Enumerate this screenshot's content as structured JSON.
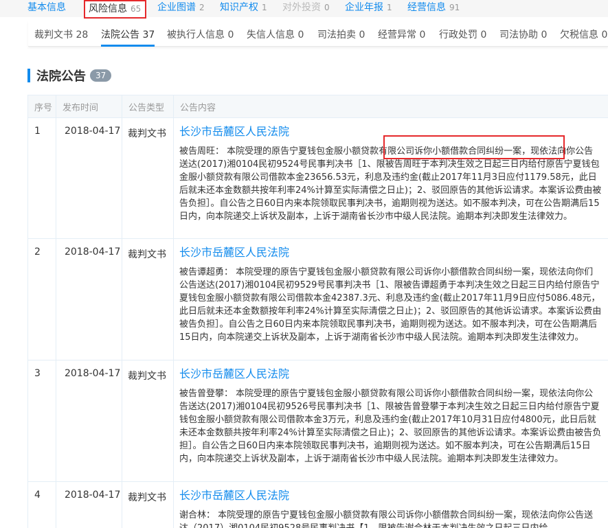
{
  "top_tabs": [
    {
      "label": "基本信息",
      "count": ""
    },
    {
      "label": "风险信息",
      "count": "65"
    },
    {
      "label": "企业图谱",
      "count": "2"
    },
    {
      "label": "知识产权",
      "count": "1"
    },
    {
      "label": "对外投资",
      "count": "0"
    },
    {
      "label": "企业年报",
      "count": "1"
    },
    {
      "label": "经营信息",
      "count": "91"
    }
  ],
  "sub_tabs": [
    {
      "label": "裁判文书",
      "count": "28"
    },
    {
      "label": "法院公告",
      "count": "37"
    },
    {
      "label": "被执行人信息",
      "count": "0"
    },
    {
      "label": "失信人信息",
      "count": "0"
    },
    {
      "label": "司法拍卖",
      "count": "0"
    },
    {
      "label": "经营异常",
      "count": "0"
    },
    {
      "label": "行政处罚",
      "count": "0"
    },
    {
      "label": "司法协助",
      "count": "0"
    },
    {
      "label": "欠税信息",
      "count": "0"
    }
  ],
  "section": {
    "title": "法院公告",
    "badge": "37"
  },
  "table": {
    "headers": [
      "序号",
      "发布时间",
      "公告类型",
      "公告内容"
    ],
    "rows": [
      {
        "no": "1",
        "date": "2018-04-17",
        "type": "裁判文书",
        "court": "长沙市岳麓区人民法院",
        "text": "被告周旺： 本院受理的原告宁夏钱包金服小额贷款有限公司诉你小额借款合同纠纷一案，现依法向你公告送达(2017)湘0104民初9524号民事判决书［1、限被告周旺于本判决生效之日起三日内给付原告宁夏钱包金服小额贷款有限公司借款本金23656.53元，利息及违约金(截止2017年11月3日应付1179.58元，此日后就未还本金数额共按年利率24%计算至实际清偿之日止)；2、驳回原告的其他诉讼请求。本案诉讼费由被告负担］。自公告之日60日内来本院领取民事判决书，逾期则视为送达。如不服本判决，可在公告期满后15日内，向本院递交上诉状及副本，上诉于湖南省长沙市中级人民法院。逾期本判决即发生法律效力。"
      },
      {
        "no": "2",
        "date": "2018-04-17",
        "type": "裁判文书",
        "court": "长沙市岳麓区人民法院",
        "text": "被告谭超勇： 本院受理的原告宁夏钱包金服小额贷款有限公司诉你小额借款合同纠纷一案，现依法向你们公告送达(2017)湘0104民初9529号民事判决书［1、限被告谭超勇于本判决生效之日起三日内给付原告宁夏钱包金服小额贷款有限公司借款本金42387.3元、利息及违约金(截止2017年11月9日应付5086.48元，此日后就未还本金数额按年利率24%计算至实际清偿之日止)；2、驳回原告的其他诉讼请求。本案诉讼费由被告负担］。自公告之日60日内来本院领取民事判决书，逾期则视为送达。如不服本判决，可在公告期满后15日内，向本院递交上诉状及副本，上诉于湖南省长沙市中级人民法院。逾期本判决即发生法律效力。"
      },
      {
        "no": "3",
        "date": "2018-04-17",
        "type": "裁判文书",
        "court": "长沙市岳麓区人民法院",
        "text": "被告曾登攀： 本院受理的原告宁夏钱包金服小额贷款有限公司诉你小额借款合同纠纷一案，现依法向你公告送达(2017)湘0104民初9526号民事判决书［1、限被告曾登攀于本判决生效之日起三日内给付原告宁夏钱包金服小额贷款有限公司借款本金3万元，利息及违约金(截止2017年10月31日应付4800元，此日后就未还本金数额共按年利率24%计算至实际清偿之日止)；2、驳回原告的其他诉讼请求。本案诉讼费由被告负担］。自公告之日60日内来本院领取民事判决书，逾期则视为送达。如不服本判决，可在公告期满后15日内，向本院递交上诉状及副本，上诉于湖南省长沙市中级人民法院。逾期本判决即发生法律效力。"
      },
      {
        "no": "4",
        "date": "2018-04-17",
        "type": "裁判文书",
        "court": "长沙市岳麓区人民法院",
        "text": "谢合林： 本院受理的原告宁夏钱包金服小额贷款有限公司诉你小额借款合同纠纷一案，现依法向你公告送达（2017）湘0104民初9528号民事判决书【1、限被告谢合林于本判决生效之日起三日内给"
      }
    ]
  },
  "colors": {
    "accent": "#128bed",
    "highlight": "#e5282b"
  }
}
